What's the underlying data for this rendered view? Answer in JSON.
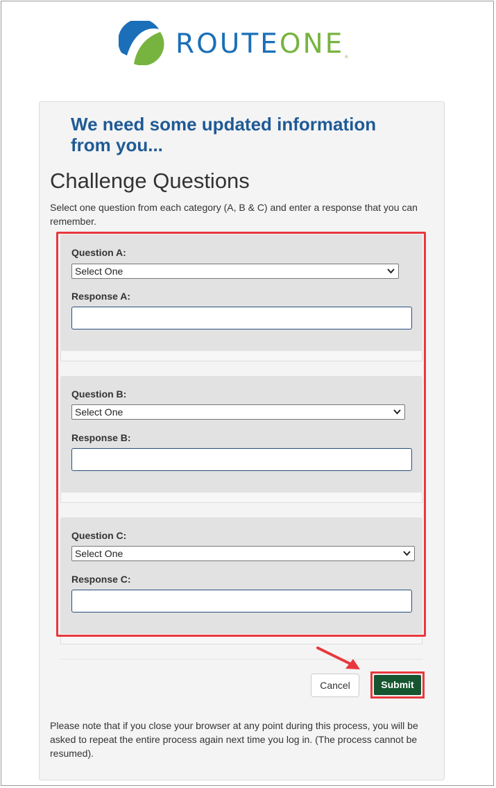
{
  "logo": {
    "route": "ROUTE",
    "one": "ONE",
    "reg": "®"
  },
  "headline": "We need some updated information from you...",
  "section_title": "Challenge Questions",
  "instructions": "Select one question from each category (A, B & C) and enter a response that you can remember.",
  "questions": [
    {
      "question_label": "Question A:",
      "selected": "Select One",
      "response_label": "Response A:",
      "response_value": ""
    },
    {
      "question_label": "Question B:",
      "selected": "Select One",
      "response_label": "Response B:",
      "response_value": ""
    },
    {
      "question_label": "Question C:",
      "selected": "Select One",
      "response_label": "Response C:",
      "response_value": ""
    }
  ],
  "buttons": {
    "cancel": "Cancel",
    "submit": "Submit"
  },
  "note": "Please note that if you close your browser at any point during this process, you will be asked to repeat the entire process again next time you log in. (The process cannot be resumed).",
  "colors": {
    "brand_blue": "#1a6fb8",
    "brand_green": "#77b43f",
    "submit": "#15552f",
    "highlight": "#e8383d"
  }
}
